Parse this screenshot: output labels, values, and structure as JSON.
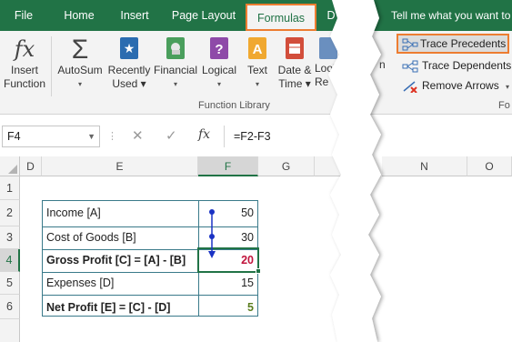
{
  "tabs": [
    "File",
    "Home",
    "Insert",
    "Page Layout",
    "Formulas",
    "D"
  ],
  "tell_me": "Tell me what you want to",
  "ribbon_buttons": [
    {
      "label1": "Insert",
      "label2": "Function",
      "icon": "fx-icon"
    },
    {
      "label1": "AutoSum",
      "label2": "▾",
      "icon": "sigma-icon"
    },
    {
      "label1": "Recently",
      "label2": "Used ▾",
      "icon": "star-book-icon"
    },
    {
      "label1": "Financial",
      "label2": "▾",
      "icon": "financial-book-icon"
    },
    {
      "label1": "Logical",
      "label2": "▾",
      "icon": "question-book-icon"
    },
    {
      "label1": "Text",
      "label2": "▾",
      "icon": "text-book-icon"
    },
    {
      "label1": "Date &",
      "label2": "Time ▾",
      "icon": "calendar-book-icon"
    },
    {
      "label1": "Look",
      "label2": "Re",
      "icon": "lookup-book-icon"
    }
  ],
  "function_library_label": "Function Library",
  "auditing": {
    "trace_precedents": "Trace Precedents",
    "trace_dependents": "Trace Dependents",
    "remove_arrows": "Remove Arrows",
    "group_label_fragment": "Fo",
    "left_fragment": "n"
  },
  "formula_bar": {
    "name_box": "F4",
    "fx": "fx",
    "formula": "=F2-F3"
  },
  "columns_left": [
    "D",
    "E",
    "F",
    "G"
  ],
  "columns_right": [
    "N",
    "O"
  ],
  "rows": [
    "1",
    "2",
    "3",
    "4",
    "5",
    "6"
  ],
  "table": [
    {
      "label": "Income [A]",
      "value": "50",
      "bold": false
    },
    {
      "label": "Cost of Goods [B]",
      "value": "30",
      "bold": false
    },
    {
      "label": "Gross Profit [C] = [A] - [B]",
      "value": "20",
      "bold": true
    },
    {
      "label": "Expenses [D]",
      "value": "15",
      "bold": false
    },
    {
      "label": "Net Profit [E] = [C] - [D]",
      "value": "5",
      "bold": true
    }
  ],
  "colors": {
    "excel_green": "#217346",
    "highlight_orange": "#ed7d31",
    "arrow_blue": "#1a32c4",
    "red_value": "#c0143c",
    "green_value": "#5a7d1e"
  }
}
